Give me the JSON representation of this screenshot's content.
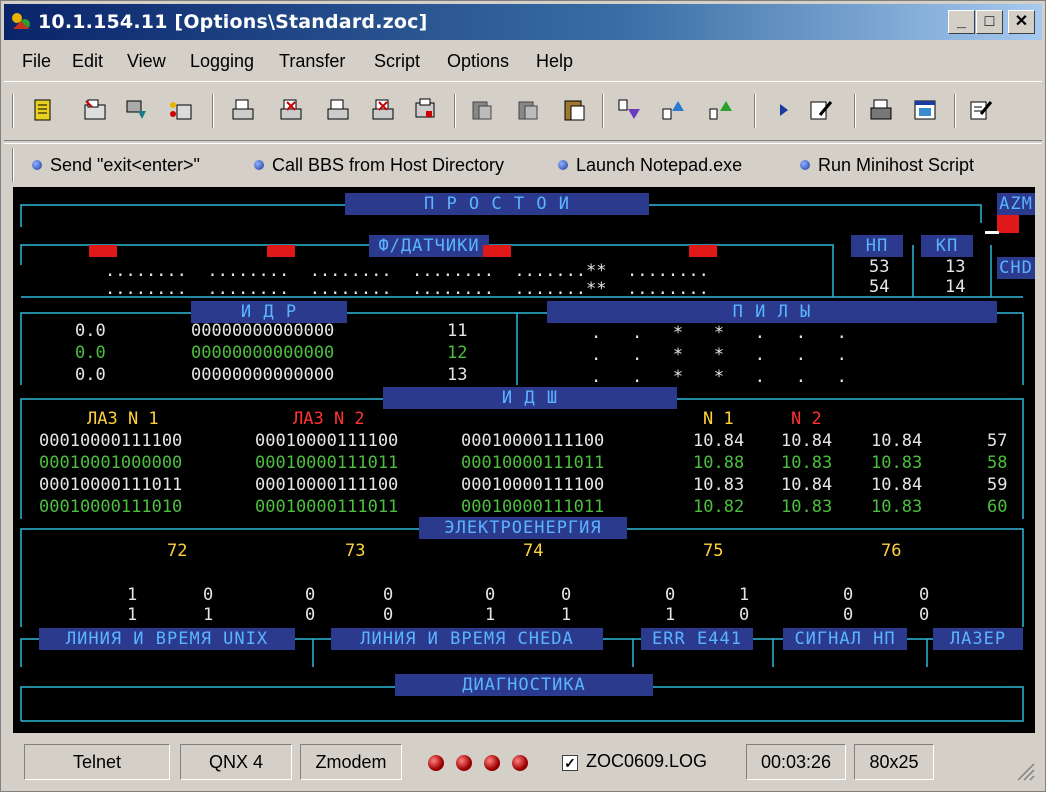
{
  "window": {
    "title": "10.1.154.11 [Options\\Standard.zoc]"
  },
  "menu": [
    "File",
    "Edit",
    "View",
    "Logging",
    "Transfer",
    "Script",
    "Options",
    "Help"
  ],
  "toolbar_icons": [
    "notebook-icon",
    "phonebook-icon",
    "host-connect-icon",
    "session-icon",
    "print-icon",
    "print-cancel-icon",
    "print-icon-2",
    "print-cancel-icon-2",
    "fax-icon",
    "copy-icon",
    "paste-icon",
    "clipboard-icon",
    "download-icon",
    "upload-icon",
    "upload-multi-icon",
    "play-script-icon",
    "edit-script-icon",
    "printer-icon",
    "window-icon",
    "notepad-icon"
  ],
  "quickbar": [
    "Send \"exit<enter>\"",
    "Call BBS from Host Directory",
    "Launch Notepad.exe",
    "Run Minihost Script"
  ],
  "terminal": {
    "headers": {
      "prostoi": "П Р О С Т О И",
      "azm": "AZM",
      "datchiki": "Ф/ДАТЧИКИ",
      "np": "НП",
      "kp": "КП",
      "chd": "CHD",
      "idr": "И Д Р",
      "pily": "П И Л Ы",
      "idsh": "И Д Ш",
      "elektro": "ЭЛЕКТРОЕНЕРГИЯ",
      "unix": "ЛИНИЯ И ВРЕМЯ UNIX",
      "cheda": "ЛИНИЯ И ВРЕМЯ CHEDA",
      "err": "ERR E441",
      "signal": "СИГНАЛ НП",
      "lazer": "ЛАЗЕР",
      "diag": "ДИАГНОСТИКА"
    },
    "datchiki_rows": [
      "........  ........  ........  ........  .......**  ........",
      "........  ........  ........  ........  .......**  ........"
    ],
    "np_values": [
      "53",
      "54"
    ],
    "kp_values": [
      "13",
      "14"
    ],
    "idr_rows": [
      {
        "a": "0.0",
        "b": "00000000000000",
        "c": "11"
      },
      {
        "a": "0.0",
        "b": "00000000000000",
        "c": "12"
      },
      {
        "a": "0.0",
        "b": "00000000000000",
        "c": "13"
      }
    ],
    "pily_rows": [
      ".   .   *   *   .   .   .",
      ".   .   *   *   .   .   .",
      ".   .   *   *   .   .   ."
    ],
    "idsh_labels": {
      "laz1": "ЛАЗ N 1",
      "laz2": "ЛАЗ N 2",
      "n1": "N 1",
      "n2": "N 2"
    },
    "idsh_rows": [
      {
        "c1": "00010000111100",
        "c2": "00010000111100",
        "c3": "00010000111100",
        "v1": "10.84",
        "v2": "10.84",
        "v3": "10.84",
        "n": "57"
      },
      {
        "c1": "00010001000000",
        "c2": "00010000111011",
        "c3": "00010000111011",
        "v1": "10.88",
        "v2": "10.83",
        "v3": "10.83",
        "n": "58"
      },
      {
        "c1": "00010000111011",
        "c2": "00010000111100",
        "c3": "00010000111100",
        "v1": "10.83",
        "v2": "10.84",
        "v3": "10.84",
        "n": "59"
      },
      {
        "c1": "00010000111010",
        "c2": "00010000111011",
        "c3": "00010000111011",
        "v1": "10.82",
        "v2": "10.83",
        "v3": "10.83",
        "n": "60"
      }
    ],
    "elektro_cols": [
      "72",
      "73",
      "74",
      "75",
      "76"
    ],
    "elektro_row1": [
      "1",
      "0",
      "0",
      "0",
      "0",
      "0",
      "0",
      "1",
      "0",
      "0"
    ],
    "elektro_row2": [
      "1",
      "1",
      "0",
      "0",
      "1",
      "1",
      "1",
      "0",
      "0",
      "0"
    ]
  },
  "status": {
    "protocol": "Telnet",
    "emulation": "QNX 4",
    "transfer": "Zmodem",
    "log_checked": "✓",
    "log": "ZOC0609.LOG",
    "time": "00:03:26",
    "size": "80x25"
  }
}
